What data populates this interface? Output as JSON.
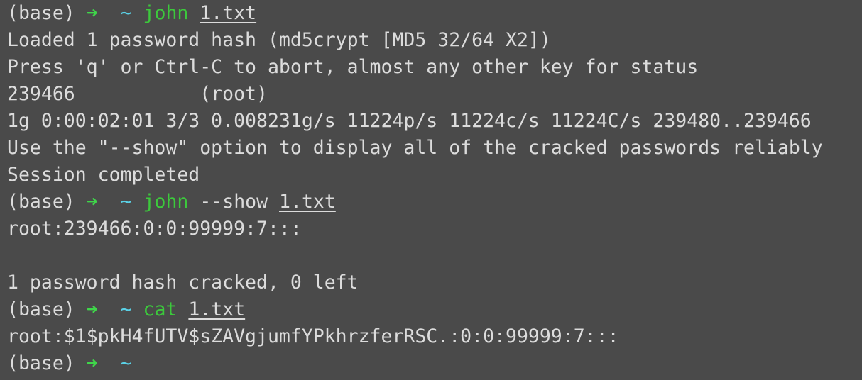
{
  "prompt": {
    "env": "(base)",
    "arrow": "➜",
    "dir": "~"
  },
  "session": [
    {
      "command": "john",
      "args": "",
      "file": "1.txt"
    },
    {
      "command": "john",
      "args": "--show",
      "file": "1.txt"
    },
    {
      "command": "cat",
      "args": "",
      "file": "1.txt"
    }
  ],
  "output1": [
    "Loaded 1 password hash (md5crypt [MD5 32/64 X2])",
    "Press 'q' or Ctrl-C to abort, almost any other key for status",
    "239466           (root)",
    "1g 0:00:02:01 3/3 0.008231g/s 11224p/s 11224c/s 11224C/s 239480..239466",
    "Use the \"--show\" option to display all of the cracked passwords reliably",
    "Session completed"
  ],
  "output2": [
    "root:239466:0:0:99999:7:::",
    "",
    "1 password hash cracked, 0 left"
  ],
  "output3": [
    "root:$1$pkH4fUTV$sZAVgjumfYPkhrzferRSC.:0:0:99999:7:::"
  ],
  "colors": {
    "background": "#4a4a4a",
    "text": "#dcdcdc",
    "arrow": "#3fd64a",
    "tilde": "#5ad1e6",
    "command": "#3cc93c"
  }
}
